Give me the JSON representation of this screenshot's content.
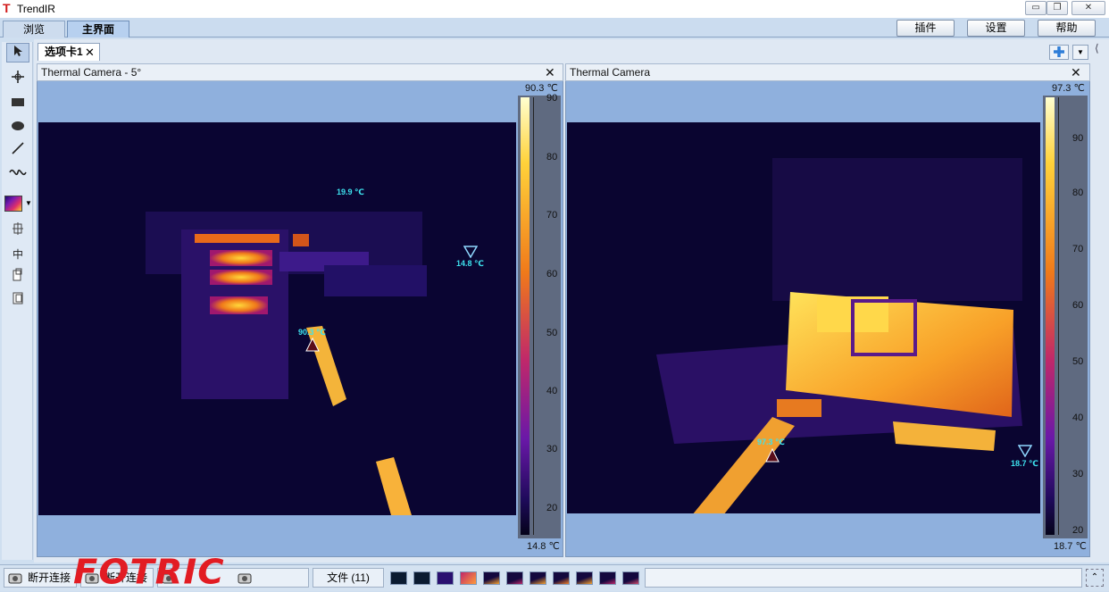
{
  "app": {
    "title": "TrendIR"
  },
  "main_tabs": [
    {
      "label": "浏览"
    },
    {
      "label": "主界面"
    }
  ],
  "top_buttons": {
    "plugins": "插件",
    "settings": "设置",
    "help": "帮助"
  },
  "doc_tab": {
    "label": "选项卡1"
  },
  "panels": [
    {
      "title": "Thermal Camera - 5°",
      "scale_max": "90.3 ℃",
      "scale_min": "14.8 ℃",
      "ticks": [
        "90",
        "80",
        "70",
        "60",
        "50",
        "40",
        "30",
        "20"
      ],
      "markers": [
        {
          "label": "19.9 ℃",
          "type": "spot"
        },
        {
          "label": "14.8 ℃",
          "type": "min"
        },
        {
          "label": "90.3 ℃",
          "type": "max"
        }
      ]
    },
    {
      "title": "Thermal Camera",
      "scale_max": "97.3 ℃",
      "scale_min": "18.7 ℃",
      "ticks": [
        "90",
        "80",
        "70",
        "60",
        "50",
        "40",
        "30",
        "20"
      ],
      "markers": [
        {
          "label": "97.3 ℃",
          "type": "max"
        },
        {
          "label": "18.7 ℃",
          "type": "min"
        }
      ]
    }
  ],
  "status": {
    "disconnect_1": "断开连接",
    "disconnect_2": "断开连接",
    "files": "文件 (11)"
  },
  "watermark": "FOTRIC",
  "icons": [
    "pointer-icon",
    "crosshair-icon",
    "rectangle-icon",
    "ellipse-icon",
    "line-icon",
    "polyline-icon",
    "palette-icon",
    "ruler-icon",
    "center-icon",
    "copy-icon",
    "paste-icon",
    "add-icon",
    "camera-icon"
  ]
}
